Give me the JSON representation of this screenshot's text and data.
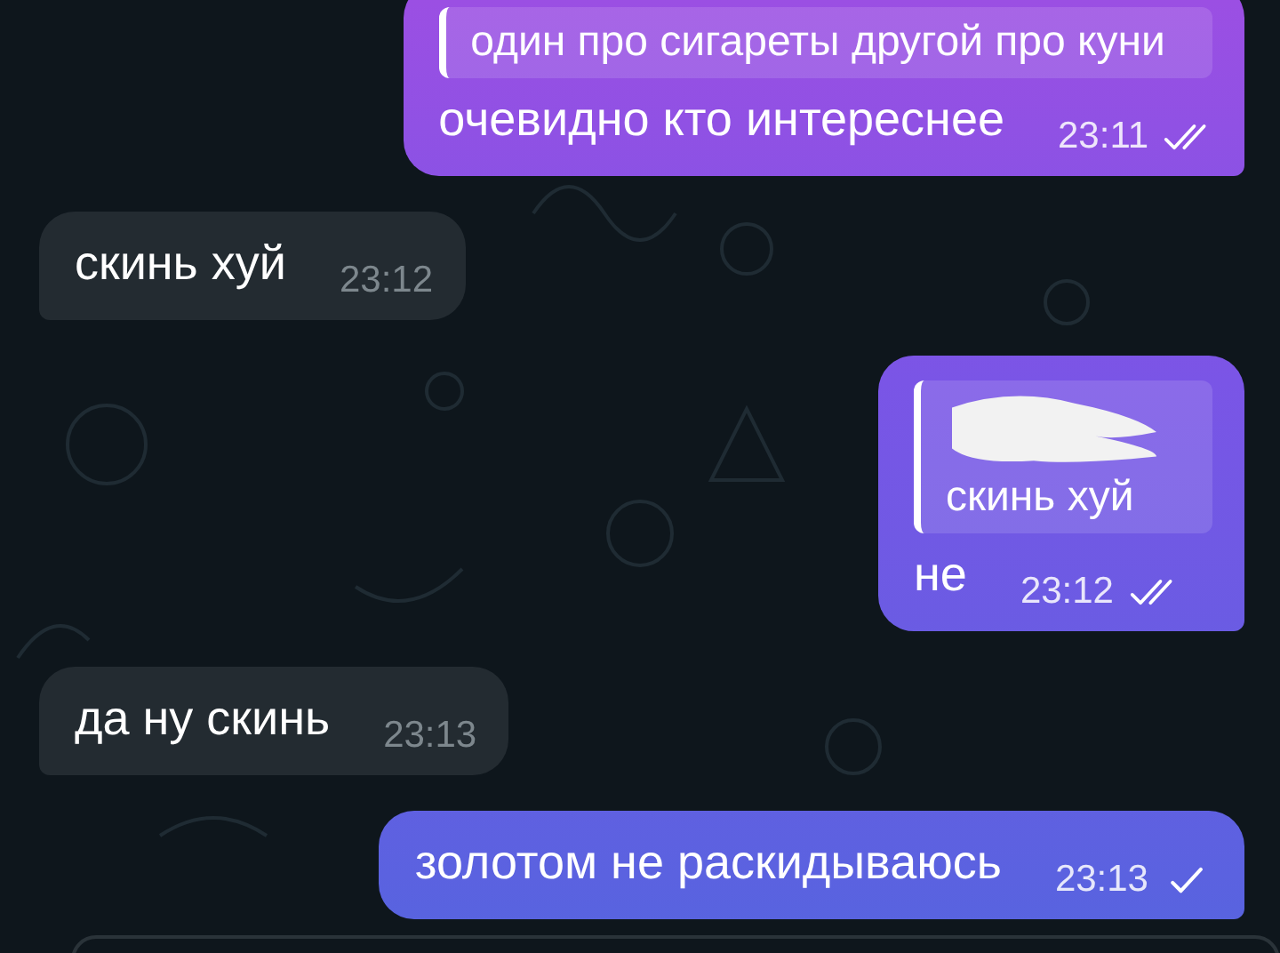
{
  "messages": [
    {
      "outgoing": true,
      "reply": {
        "text": "один про сигареты другой про куни"
      },
      "text": "очевидно кто интереснее",
      "time": "23:11",
      "read": true
    },
    {
      "outgoing": false,
      "text": "скинь хуй",
      "time": "23:12"
    },
    {
      "outgoing": true,
      "reply": {
        "text": "скинь хуй"
      },
      "text": "не",
      "time": "23:12",
      "read": true
    },
    {
      "outgoing": false,
      "text": "да ну скинь",
      "time": "23:13"
    },
    {
      "outgoing": true,
      "text": "золотом не раскидываюсь",
      "time": "23:13",
      "read": false
    }
  ]
}
